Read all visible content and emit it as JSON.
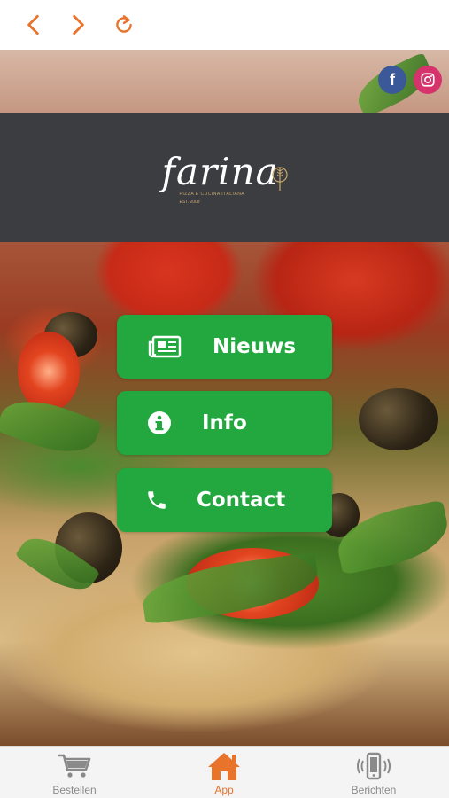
{
  "colors": {
    "accent": "#e8742c",
    "button_green": "#22a83f",
    "banner_bg": "#3c3d41",
    "facebook": "#3b5998",
    "instagram": "#d6336c",
    "tab_inactive": "#8a8a8a"
  },
  "nav": {
    "back_icon": "chevron-left-icon",
    "forward_icon": "chevron-right-icon",
    "reload_icon": "reload-icon"
  },
  "social": {
    "facebook_glyph": "f",
    "instagram_icon": "instagram-icon"
  },
  "logo": {
    "word": "farina",
    "subtitle": "PIZZA E CUCINA ITALIANA",
    "est": "EST. 2008"
  },
  "menu": {
    "nieuws": "Nieuws",
    "info": "Info",
    "contact": "Contact"
  },
  "tabs": {
    "bestellen": "Bestellen",
    "app": "App",
    "berichten": "Berichten",
    "active": "App"
  }
}
